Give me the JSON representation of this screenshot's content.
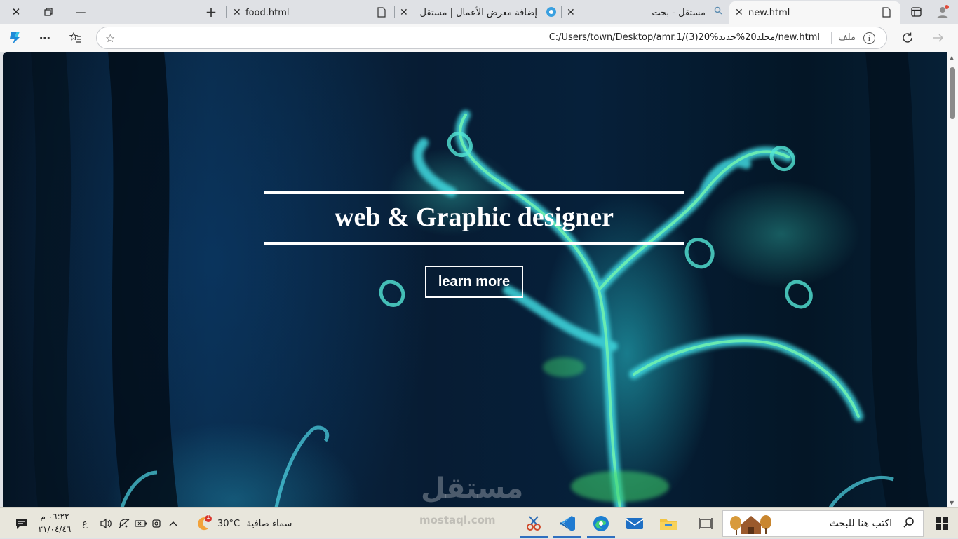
{
  "browser": {
    "tabs": [
      {
        "label": "new.html",
        "active": true
      },
      {
        "label": "مستقل - بحث",
        "active": false
      },
      {
        "label": "إضافة معرض الأعمال | مستقل",
        "active": false
      },
      {
        "label": "food.html",
        "active": false
      }
    ],
    "address": {
      "url": "C:/Users/town/Desktop/amr.1/(3)20%مجلد20%جديد/new.html",
      "scheme_label": "ملف"
    }
  },
  "page": {
    "headline": "web & Graphic designer",
    "button_label": "learn more",
    "watermark": "مستقل"
  },
  "taskbar": {
    "search_placeholder": "اكتب هنا للبحث",
    "weather_text": "سماء صافية",
    "temperature": "30°C",
    "weather_badge": "1",
    "clock_time": "٠٦:٢٢ م",
    "clock_date": "٢١/٠٤/٤٦",
    "language": "ع",
    "watermark_url": "mostaql.com"
  },
  "colors": {
    "tabstrip": "#dfe1e5",
    "toolbar": "#f7f7f7",
    "hero_text": "#ffffff",
    "taskbar": "#e8e6dc"
  }
}
